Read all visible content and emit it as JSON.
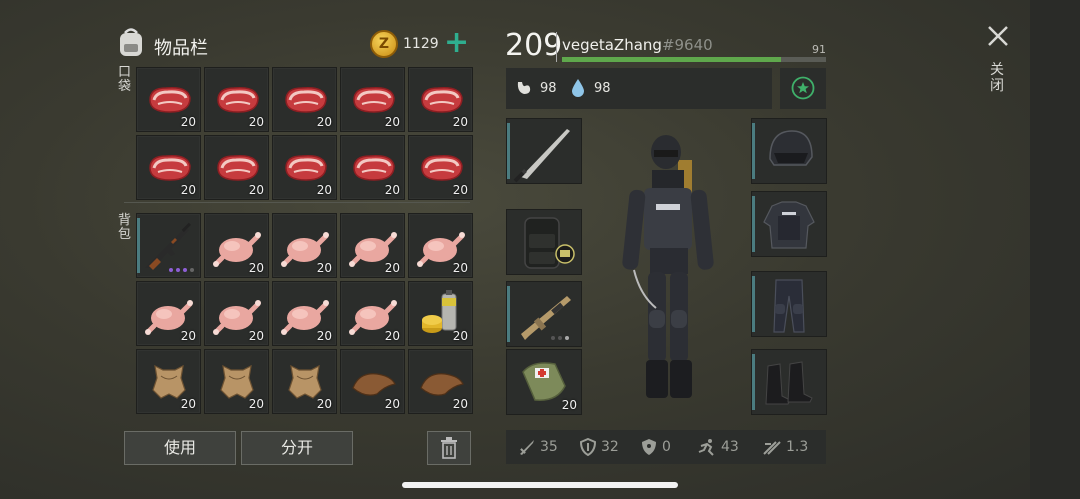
{
  "header": {
    "title": "物品栏",
    "coins": "1129",
    "level": "209",
    "player_name": "vegetaZhang",
    "player_tag": "#9640",
    "xp_value": "91",
    "xp_fraction": 0.83
  },
  "status": {
    "food": "98",
    "water": "98"
  },
  "sections": {
    "pocket": "口袋",
    "backpack": "背包"
  },
  "pocket": [
    {
      "item": "raw-meat",
      "qty": "20"
    },
    {
      "item": "raw-meat",
      "qty": "20"
    },
    {
      "item": "raw-meat",
      "qty": "20"
    },
    {
      "item": "raw-meat",
      "qty": "20"
    },
    {
      "item": "raw-meat",
      "qty": "20"
    },
    {
      "item": "raw-meat",
      "qty": "20"
    },
    {
      "item": "raw-meat",
      "qty": "20"
    },
    {
      "item": "raw-meat",
      "qty": "20"
    },
    {
      "item": "raw-meat",
      "qty": "20"
    },
    {
      "item": "raw-meat",
      "qty": "20"
    }
  ],
  "backpack": [
    {
      "item": "assault-rifle",
      "qty": ""
    },
    {
      "item": "raw-chicken",
      "qty": "20"
    },
    {
      "item": "raw-chicken",
      "qty": "20"
    },
    {
      "item": "raw-chicken",
      "qty": "20"
    },
    {
      "item": "raw-chicken",
      "qty": "20"
    },
    {
      "item": "raw-chicken",
      "qty": "20"
    },
    {
      "item": "raw-chicken",
      "qty": "20"
    },
    {
      "item": "raw-chicken",
      "qty": "20"
    },
    {
      "item": "raw-chicken",
      "qty": "20"
    },
    {
      "item": "spray-can",
      "qty": "20"
    },
    {
      "item": "animal-hide",
      "qty": "20"
    },
    {
      "item": "animal-hide",
      "qty": "20"
    },
    {
      "item": "animal-hide",
      "qty": "20"
    },
    {
      "item": "leather",
      "qty": "20"
    },
    {
      "item": "leather",
      "qty": "20"
    }
  ],
  "buttons": {
    "use": "使用",
    "split": "分开",
    "close": "关闭"
  },
  "equipment_left": [
    {
      "item": "katana",
      "qty": ""
    },
    {
      "item": "tactical-backpack",
      "qty": ""
    },
    {
      "item": "scar-rifle",
      "qty": ""
    },
    {
      "item": "medkit-bag",
      "qty": "20"
    }
  ],
  "equipment_right": [
    {
      "item": "police-helmet"
    },
    {
      "item": "police-vest"
    },
    {
      "item": "police-pants"
    },
    {
      "item": "combat-boots"
    }
  ],
  "stats": {
    "attack": "35",
    "armor": "32",
    "radiation": "0",
    "speed": "43",
    "other": "1.3"
  },
  "colors": {
    "xp_bar": "#5fa84c",
    "accent_teal": "#4b7c80",
    "coin": "#d8a21e",
    "plus": "#2fae8f"
  }
}
